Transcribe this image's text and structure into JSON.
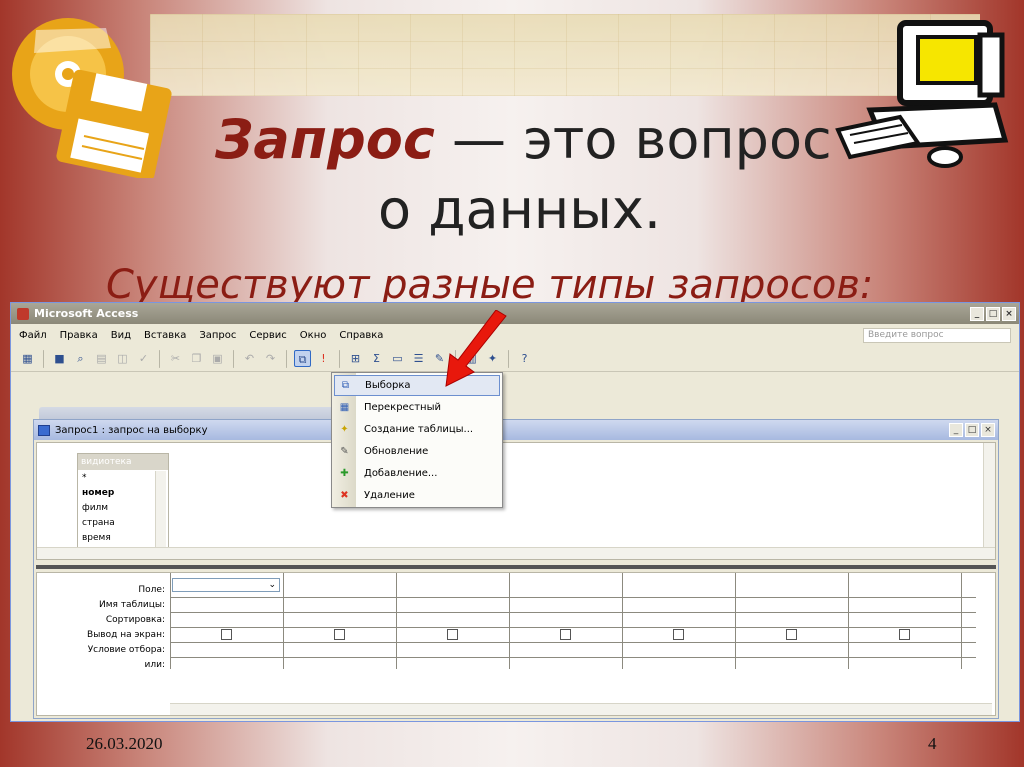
{
  "slide": {
    "title_bold": "Запрос",
    "title_rest": " — это вопрос",
    "title_line2": "о данных.",
    "subtitle": "Существуют разные типы запросов:",
    "date": "26.03.2020",
    "page": "4"
  },
  "app": {
    "title": "Microsoft Access",
    "menu": [
      "Файл",
      "Правка",
      "Вид",
      "Вставка",
      "Запрос",
      "Сервис",
      "Окно",
      "Справка"
    ],
    "help_placeholder": "Введите вопрос"
  },
  "query_window": {
    "title": "Запрос1 : запрос на выборку",
    "table_name": "видиотека",
    "fields": [
      "*",
      "номер",
      "филм",
      "страна",
      "время"
    ]
  },
  "grid": {
    "row_labels": [
      "Поле:",
      "Имя таблицы:",
      "Сортировка:",
      "Вывод на экран:",
      "Условие отбора:",
      "или:"
    ]
  },
  "dropdown": {
    "items": [
      {
        "label": "Выборка",
        "icon": "select-query-icon"
      },
      {
        "label": "Перекрестный",
        "icon": "crosstab-query-icon"
      },
      {
        "label": "Создание таблицы...",
        "icon": "make-table-query-icon"
      },
      {
        "label": "Обновление",
        "icon": "update-query-icon"
      },
      {
        "label": "Добавление...",
        "icon": "append-query-icon"
      },
      {
        "label": "Удаление",
        "icon": "delete-query-icon"
      }
    ],
    "selected": "Выборка"
  },
  "colors": {
    "accent": "#8b1d14",
    "arrow": "#e8180c"
  }
}
